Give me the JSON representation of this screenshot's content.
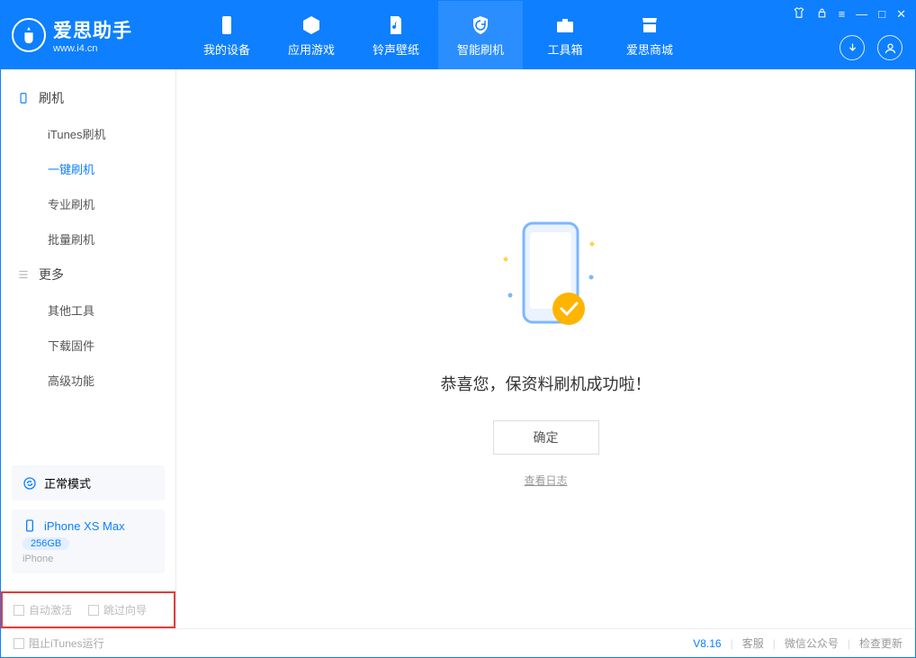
{
  "logo": {
    "title": "爱思助手",
    "subtitle": "www.i4.cn"
  },
  "nav": [
    {
      "label": "我的设备"
    },
    {
      "label": "应用游戏"
    },
    {
      "label": "铃声壁纸"
    },
    {
      "label": "智能刷机"
    },
    {
      "label": "工具箱"
    },
    {
      "label": "爱思商城"
    }
  ],
  "sidebar": {
    "group1": "刷机",
    "items1": [
      "iTunes刷机",
      "一键刷机",
      "专业刷机",
      "批量刷机"
    ],
    "group2": "更多",
    "items2": [
      "其他工具",
      "下载固件",
      "高级功能"
    ]
  },
  "mode_card": {
    "label": "正常模式"
  },
  "device_card": {
    "name": "iPhone XS Max",
    "storage": "256GB",
    "type": "iPhone"
  },
  "side_checks": {
    "auto_activate": "自动激活",
    "skip_guide": "跳过向导"
  },
  "main": {
    "success": "恭喜您，保资料刷机成功啦！",
    "ok": "确定",
    "view_log": "查看日志"
  },
  "footer": {
    "block_itunes": "阻止iTunes运行",
    "version": "V8.16",
    "support": "客服",
    "wechat": "微信公众号",
    "update": "检查更新"
  }
}
